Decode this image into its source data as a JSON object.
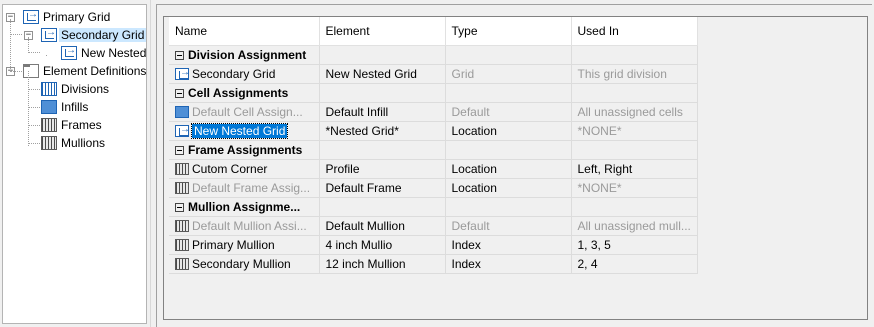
{
  "tree": [
    {
      "label": "Primary Grid",
      "icon": "grid-icon",
      "expander": "−"
    },
    {
      "label": "Secondary Grid",
      "icon": "grid-icon",
      "expander": "−"
    },
    {
      "label": "New Nested",
      "icon": "grid-icon"
    },
    {
      "label": "Element Definitions",
      "icon": "folder-icon",
      "expander": "−"
    },
    {
      "label": "Divisions",
      "icon": "divisions-icon"
    },
    {
      "label": "Infills",
      "icon": "infill-icon"
    },
    {
      "label": "Frames",
      "icon": "frame-icon"
    },
    {
      "label": "Mullions",
      "icon": "mullion-icon"
    }
  ],
  "table": {
    "columns": [
      "Name",
      "Element",
      "Type",
      "Used In"
    ],
    "rows": [
      {
        "kind": "section",
        "name": "Division Assignment"
      },
      {
        "kind": "row",
        "icon": "grid-icon",
        "name": "Secondary Grid",
        "element": "New Nested Grid",
        "type": "Grid",
        "used_in": "This grid division",
        "gray": [
          false,
          false,
          true,
          true
        ]
      },
      {
        "kind": "section",
        "name": "Cell Assignments"
      },
      {
        "kind": "row",
        "icon": "infill-icon",
        "name": "Default Cell Assign...",
        "element": "Default Infill",
        "type": "Default",
        "used_in": "All unassigned cells",
        "gray": [
          true,
          false,
          true,
          true
        ]
      },
      {
        "kind": "row",
        "icon": "grid-icon",
        "name": "New Nested Grid",
        "element": "*Nested Grid*",
        "type": "Location",
        "used_in": "*NONE*",
        "gray": [
          false,
          false,
          false,
          true
        ],
        "selected": true
      },
      {
        "kind": "section",
        "name": "Frame Assignments"
      },
      {
        "kind": "row",
        "icon": "frame-icon",
        "name": "Cutom Corner",
        "element": "Profile",
        "type": "Location",
        "used_in": "Left, Right",
        "gray": [
          false,
          false,
          false,
          false
        ]
      },
      {
        "kind": "row",
        "icon": "frame-icon",
        "name": "Default Frame Assig...",
        "element": "Default Frame",
        "type": "Location",
        "used_in": "*NONE*",
        "gray": [
          true,
          false,
          false,
          true
        ]
      },
      {
        "kind": "section",
        "name": "Mullion Assignme..."
      },
      {
        "kind": "row",
        "icon": "mullion-icon",
        "name": "Default Mullion Assi...",
        "element": "Default Mullion",
        "type": "Default",
        "used_in": "All unassigned mull...",
        "gray": [
          true,
          false,
          true,
          true
        ]
      },
      {
        "kind": "row",
        "icon": "mullion-icon",
        "name": "Primary Mullion",
        "element": "4 inch Mullio",
        "type": "Index",
        "used_in": "1, 3, 5",
        "gray": [
          false,
          false,
          false,
          false
        ]
      },
      {
        "kind": "row",
        "icon": "mullion-icon",
        "name": "Secondary Mullion",
        "element": "12 inch Mullion",
        "type": "Index",
        "used_in": "2, 4",
        "gray": [
          false,
          false,
          false,
          false
        ]
      }
    ]
  }
}
